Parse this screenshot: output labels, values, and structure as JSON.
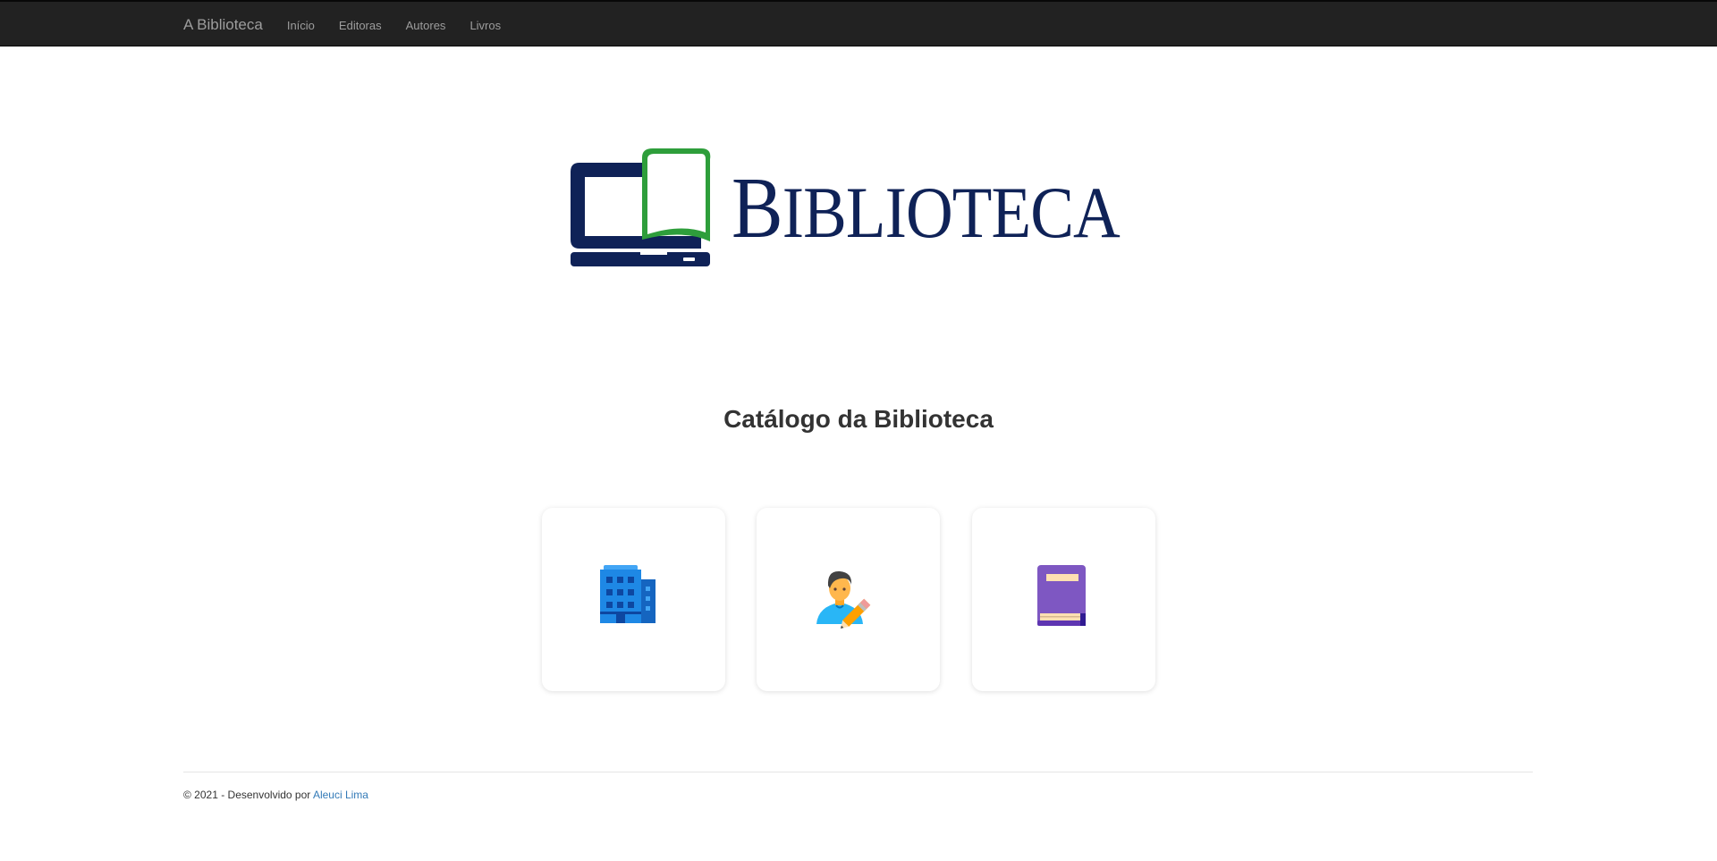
{
  "navbar": {
    "brand": "A Biblioteca",
    "links": [
      "Início",
      "Editoras",
      "Autores",
      "Livros"
    ]
  },
  "logo": {
    "text_big_first": "B",
    "text_rest": "IBLIOTECA",
    "icon": "laptop-book-icon",
    "colors": {
      "navy": "#0f2257",
      "green": "#2e9e3b"
    }
  },
  "catalog": {
    "title": "Catálogo da Biblioteca",
    "cards": [
      {
        "icon": "building-icon"
      },
      {
        "icon": "writer-icon"
      },
      {
        "icon": "book-icon"
      }
    ]
  },
  "footer": {
    "text": "© 2021 - Desenvolvido por ",
    "link_text": "Aleuci Lima"
  },
  "colors": {
    "navbar_bg": "#222222",
    "nav_text": "#9d9d9d",
    "link": "#337ab7"
  }
}
